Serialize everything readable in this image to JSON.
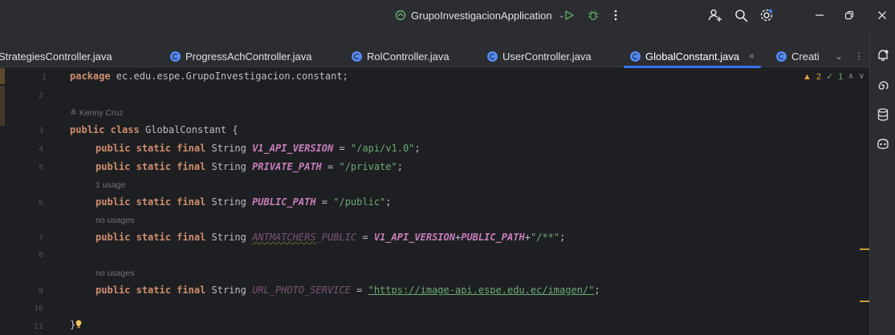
{
  "titlebar": {
    "run_config_label": "GrupoInvestigacionApplication",
    "icons": [
      "run-config-icon",
      "chevron-down-icon",
      "run-icon",
      "debug-icon",
      "more-icon",
      "add-user-icon",
      "search-icon",
      "settings-icon",
      "minimize-icon",
      "restore-icon",
      "close-icon"
    ]
  },
  "tabs": [
    {
      "label": "StrategiesController.java",
      "active": false
    },
    {
      "label": "ProgressAchController.java",
      "active": false
    },
    {
      "label": "RolController.java",
      "active": false
    },
    {
      "label": "UserController.java",
      "active": false
    },
    {
      "label": "GlobalConstant.java",
      "active": true,
      "close": "×"
    },
    {
      "label": "Creati",
      "active": false
    }
  ],
  "tab_tools": {
    "chevron": "⌄",
    "more": "⋮"
  },
  "inspections": {
    "warnings": "2",
    "weak_warnings": "1"
  },
  "gutter": {
    "line_numbers": [
      "1",
      "2",
      "3",
      "4",
      "5",
      "6",
      "7",
      "8",
      "9",
      "10",
      "11"
    ]
  },
  "code": {
    "line1": {
      "keyword": "package",
      "rest": " ec.edu.espe.GrupoInvestigacion.constant;"
    },
    "author_hint": "Kenny Cruz",
    "line3": {
      "kw1": "public",
      "kw2": "class",
      "name": " GlobalConstant {"
    },
    "line4": {
      "mods": "public static final",
      "type": " String ",
      "const": "V1_API_VERSION",
      "eq": " = ",
      "value": "\"/api/v1.0\"",
      "end": ";"
    },
    "line5": {
      "mods": "public static final",
      "type": " String ",
      "const": "PRIVATE_PATH",
      "eq": " = ",
      "value": "\"/private\"",
      "end": ";"
    },
    "usage_hint_6": "1 usage",
    "line6": {
      "mods": "public static final",
      "type": " String ",
      "const": "PUBLIC_PATH",
      "eq": " = ",
      "value": "\"/public\"",
      "end": ";"
    },
    "usage_hint_7": "no usages",
    "line7": {
      "mods": "public static final",
      "type": " String ",
      "const_a": "ANTMATCHERS",
      "const_b": "_PUBLIC",
      "eq": " = ",
      "expr_a": "V1_API_VERSION",
      "plus1": "+",
      "expr_b": "PUBLIC_PATH",
      "plus2": "+",
      "value": "\"/**\"",
      "end": ";"
    },
    "usage_hint_9": "no usages",
    "line9": {
      "mods": "public static final",
      "type": " String ",
      "const": "URL_PHOTO_SERVICE",
      "eq": " = ",
      "value": "\"https://image-api.espe.edu.ec/imagen/\"",
      "end": ";"
    },
    "line11": {
      "brace": "}"
    }
  },
  "colors": {
    "background": "#1e1f22",
    "panel": "#2b2d30",
    "keyword": "#cf8e6d",
    "constant": "#c77dbb",
    "string": "#6aab73",
    "accent": "#3574f0",
    "warning": "#e0a642"
  }
}
